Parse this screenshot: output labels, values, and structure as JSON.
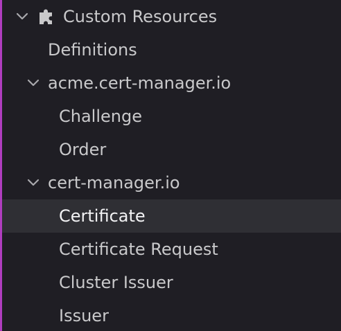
{
  "colors": {
    "background": "#1f1e24",
    "accent": "#b03dbf",
    "text": "#c9c9cb",
    "selected_bg": "#2f2f34",
    "selected_text": "#f3f3f5"
  },
  "tree": {
    "root": {
      "label": "Custom Resources",
      "icon": "puzzle-icon",
      "expanded": true
    },
    "definitions": {
      "label": "Definitions"
    },
    "groups": [
      {
        "label": "acme.cert-manager.io",
        "expanded": true,
        "items": [
          {
            "label": "Challenge"
          },
          {
            "label": "Order"
          }
        ]
      },
      {
        "label": "cert-manager.io",
        "expanded": true,
        "items": [
          {
            "label": "Certificate",
            "selected": true
          },
          {
            "label": "Certificate Request"
          },
          {
            "label": "Cluster Issuer"
          },
          {
            "label": "Issuer"
          }
        ]
      }
    ]
  }
}
